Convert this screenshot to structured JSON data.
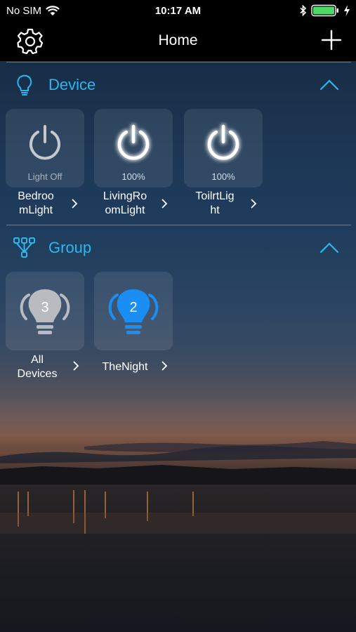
{
  "status_bar": {
    "carrier": "No SIM",
    "time": "10:17 AM",
    "icons": [
      "wifi-icon",
      "bluetooth-icon",
      "battery-icon",
      "charging-bolt-icon"
    ]
  },
  "nav": {
    "title": "Home",
    "left_icon": "gear-icon",
    "right_icon": "plus-icon"
  },
  "device_section": {
    "title": "Device",
    "icon": "lightbulb-outline-icon",
    "expanded": true,
    "devices": [
      {
        "name": "BedroomLight",
        "label_line1": "Bedroo",
        "label_line2": "mLight",
        "level": "Light Off",
        "on": false
      },
      {
        "name": "LivingRoomLight",
        "label_line1": "LivingRo",
        "label_line2": "omLight",
        "level": "100%",
        "on": true
      },
      {
        "name": "ToilrtLight",
        "label_line1": "ToilrtLig",
        "label_line2": "ht",
        "level": "100%",
        "on": true
      }
    ]
  },
  "group_section": {
    "title": "Group",
    "icon": "group-tree-icon",
    "expanded": true,
    "groups": [
      {
        "name": "All Devices",
        "label_line1": "All",
        "label_line2": "Devices",
        "count": "3",
        "color": "#b8bcc1"
      },
      {
        "name": "TheNight",
        "label_line1": "TheNight",
        "label_line2": "",
        "count": "2",
        "color": "#1a8ef2"
      }
    ]
  },
  "colors": {
    "accent": "#28b7ee",
    "bar": "#000000",
    "battery": "#4cd964",
    "group_blue": "#1a8ef2"
  }
}
